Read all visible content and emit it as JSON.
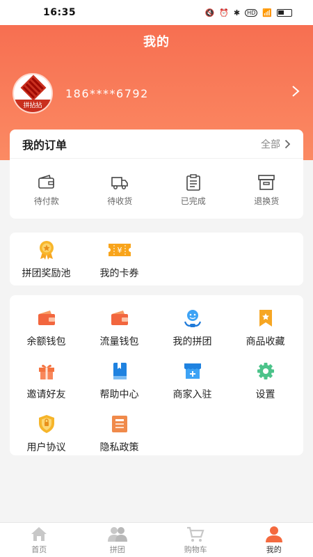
{
  "status_bar": {
    "time": "16:35",
    "icons": [
      "mute-icon",
      "alarm-icon",
      "bluetooth-icon",
      "hd-icon",
      "signal-icon",
      "battery-icon"
    ]
  },
  "header": {
    "title": "我的",
    "gradient_from": "#f66a4e",
    "gradient_to": "#fb8a63"
  },
  "profile": {
    "logo_text": "拼拈拈",
    "phone": "186****6792"
  },
  "orders": {
    "title": "我的订单",
    "all_label": "全部",
    "items": [
      {
        "label": "待付款",
        "icon": "wallet-icon"
      },
      {
        "label": "待收货",
        "icon": "truck-icon"
      },
      {
        "label": "已完成",
        "icon": "clipboard-icon"
      },
      {
        "label": "退换货",
        "icon": "box-icon"
      }
    ]
  },
  "rewards": [
    {
      "label": "拼团奖励池",
      "icon": "medal-icon"
    },
    {
      "label": "我的卡券",
      "icon": "coupon-icon"
    }
  ],
  "tools": [
    {
      "label": "余额钱包",
      "icon": "wallet-icon"
    },
    {
      "label": "流量钱包",
      "icon": "wallet-icon"
    },
    {
      "label": "我的拼团",
      "icon": "group-icon"
    },
    {
      "label": "商品收藏",
      "icon": "bookmark-star-icon"
    },
    {
      "label": "邀请好友",
      "icon": "gift-icon"
    },
    {
      "label": "帮助中心",
      "icon": "book-icon"
    },
    {
      "label": "商家入驻",
      "icon": "store-icon"
    },
    {
      "label": "设置",
      "icon": "gear-icon"
    },
    {
      "label": "用户协议",
      "icon": "shield-icon"
    },
    {
      "label": "隐私政策",
      "icon": "document-icon"
    }
  ],
  "tab_bar": {
    "active_color": "#f46a3f",
    "items": [
      {
        "label": "首页",
        "icon": "home-icon",
        "active": false
      },
      {
        "label": "拼团",
        "icon": "users-icon",
        "active": false
      },
      {
        "label": "购物车",
        "icon": "cart-icon",
        "active": false
      },
      {
        "label": "我的",
        "icon": "person-icon",
        "active": true
      }
    ]
  }
}
